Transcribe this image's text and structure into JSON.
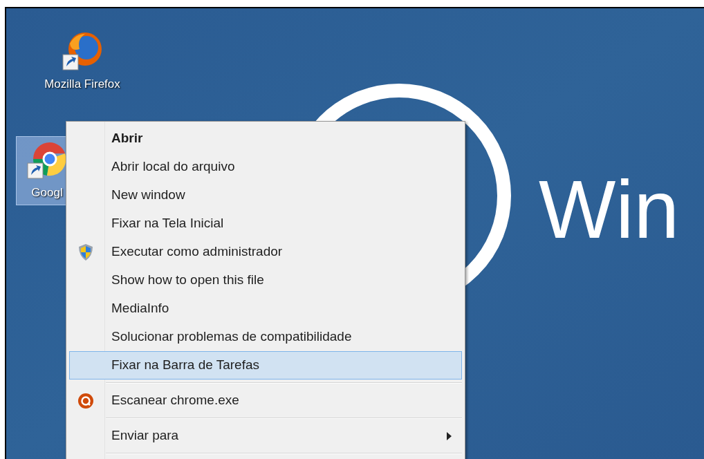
{
  "desktop": {
    "wallpaper_text": "Win",
    "icons": [
      {
        "label": "Mozilla Firefox",
        "kind": "firefox",
        "selected": false
      },
      {
        "label": "Googl",
        "kind": "chrome",
        "selected": true
      }
    ]
  },
  "context_menu": {
    "items": [
      {
        "kind": "item",
        "label": "Abrir",
        "default": true,
        "selected": false,
        "submenu": false
      },
      {
        "kind": "item",
        "label": "Abrir local do arquivo",
        "default": false,
        "selected": false,
        "submenu": false
      },
      {
        "kind": "item",
        "label": "New window",
        "default": false,
        "selected": false,
        "submenu": false
      },
      {
        "kind": "item",
        "label": "Fixar na Tela Inicial",
        "default": false,
        "selected": false,
        "submenu": false
      },
      {
        "kind": "item",
        "label": "Executar como administrador",
        "default": false,
        "selected": false,
        "submenu": false
      },
      {
        "kind": "item",
        "label": "Show how to open this file",
        "default": false,
        "selected": false,
        "submenu": false
      },
      {
        "kind": "item",
        "label": "MediaInfo",
        "default": false,
        "selected": false,
        "submenu": false
      },
      {
        "kind": "item",
        "label": "Solucionar problemas de compatibilidade",
        "default": false,
        "selected": false,
        "submenu": false
      },
      {
        "kind": "item",
        "label": "Fixar na Barra de Tarefas",
        "default": false,
        "selected": true,
        "submenu": false
      },
      {
        "kind": "separator"
      },
      {
        "kind": "item",
        "label": "Escanear chrome.exe",
        "default": false,
        "selected": false,
        "submenu": false
      },
      {
        "kind": "separator"
      },
      {
        "kind": "item",
        "label": "Enviar para",
        "default": false,
        "selected": false,
        "submenu": true
      },
      {
        "kind": "separator"
      }
    ]
  }
}
